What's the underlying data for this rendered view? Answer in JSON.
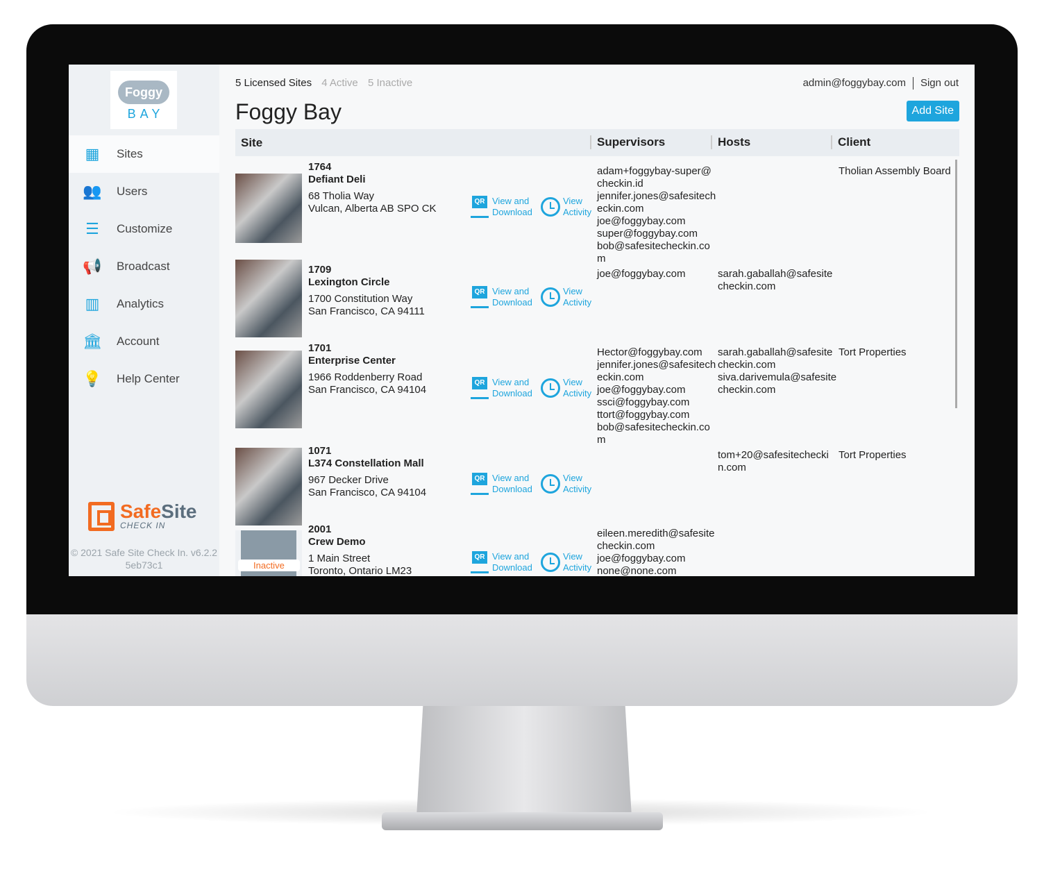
{
  "brand": {
    "logo_top": "Foggy",
    "logo_bottom": "BAY",
    "footer_logo_a": "Safe",
    "footer_logo_b": "Site",
    "footer_logo_sub": "CHECK IN",
    "copyright": "© 2021 Safe Site Check In. v6.2.2",
    "build": "5eb73c1"
  },
  "sidebar": {
    "items": [
      {
        "label": "Sites",
        "icon": "building-icon",
        "active": true
      },
      {
        "label": "Users",
        "icon": "users-icon"
      },
      {
        "label": "Customize",
        "icon": "checklist-icon"
      },
      {
        "label": "Broadcast",
        "icon": "megaphone-icon"
      },
      {
        "label": "Analytics",
        "icon": "chart-icon"
      },
      {
        "label": "Account",
        "icon": "bank-icon"
      },
      {
        "label": "Help Center",
        "icon": "lightbulb-icon"
      }
    ]
  },
  "header": {
    "licensed": "5 Licensed Sites",
    "active": "4 Active",
    "inactive": "5 Inactive",
    "title": "Foggy Bay",
    "user": "admin@foggybay.com",
    "signout": "Sign out",
    "add_site": "Add Site"
  },
  "table": {
    "columns": [
      "Site",
      "Supervisors",
      "Hosts",
      "Client"
    ],
    "qr_label_1": "View and",
    "qr_label_2": "Download",
    "activity_label_1": "View",
    "activity_label_2": "Activity",
    "rows": [
      {
        "id": "1764",
        "name": "Defiant Deli",
        "addr1": "68 Tholia Way",
        "addr2": "Vulcan, Alberta AB SPO CK",
        "supervisors": "adam+foggybay-super@checkin.id\njennifer.jones@safesitecheckin.com\njoe@foggybay.com\nsuper@foggybay.com\nbob@safesitecheckin.com",
        "hosts": "",
        "client": "Tholian Assembly Board"
      },
      {
        "id": "1709",
        "name": "Lexington Circle",
        "addr1": "1700 Constitution Way",
        "addr2": "San Francisco, CA 94111",
        "supervisors": "joe@foggybay.com",
        "hosts": "sarah.gaballah@safesitecheckin.com",
        "client": ""
      },
      {
        "id": "1701",
        "name": "Enterprise Center",
        "addr1": "1966 Roddenberry Road",
        "addr2": "San Francisco, CA 94104",
        "supervisors": "Hector@foggybay.com\njennifer.jones@safesitecheckin.com\njoe@foggybay.com\nssci@foggybay.com\nttort@foggybay.com\nbob@safesitecheckin.com",
        "hosts": "sarah.gaballah@safesitecheckin.com\nsiva.darivemula@safesitecheckin.com",
        "client": "Tort Properties"
      },
      {
        "id": "1071",
        "name": "L374 Constellation Mall",
        "addr1": "967 Decker Drive",
        "addr2": "San Francisco, CA 94104",
        "supervisors": "",
        "hosts": "tom+20@safesitecheckin.com",
        "client": "Tort Properties"
      },
      {
        "id": "2001",
        "name": "Crew Demo",
        "addr1": "1 Main Street",
        "addr2": "Toronto, Ontario LM23",
        "supervisors": "eileen.meredith@safesitecheckin.com\njoe@foggybay.com\nnone@none.com",
        "hosts": "",
        "client": "",
        "status": "Inactive"
      }
    ]
  },
  "colors": {
    "accent": "#1ea5dd",
    "brand_orange": "#f26b21"
  }
}
